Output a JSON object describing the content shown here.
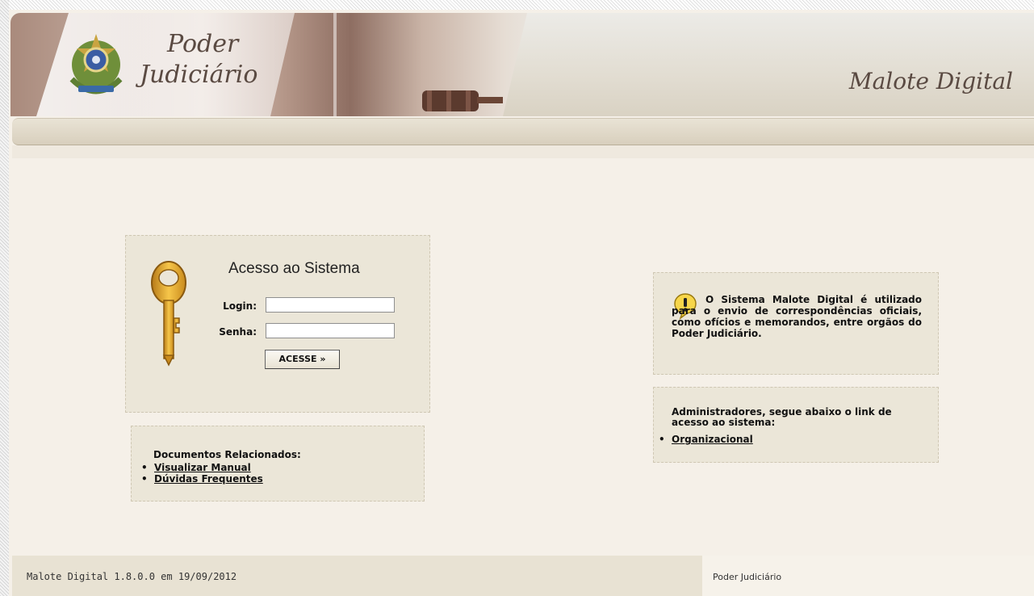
{
  "header": {
    "brand_line1": "Poder",
    "brand_line2": "Judiciário",
    "app_name": "Malote Digital"
  },
  "login": {
    "title": "Acesso ao Sistema",
    "login_label": "Login:",
    "senha_label": "Senha:",
    "login_value": "",
    "senha_value": "",
    "submit_label": "ACESSE »"
  },
  "documents": {
    "title": "Documentos Relacionados:",
    "links": [
      "Visualizar Manual",
      "Dúvidas Frequentes"
    ]
  },
  "info": {
    "text": "O Sistema Malote Digital é utilizado para o envio de correspondências oficiais, como ofícios e memorandos, entre orgãos do Poder Judiciário."
  },
  "admin": {
    "text": "Administradores, segue abaixo o link de acesso ao sistema:",
    "links": [
      "Organizacional"
    ]
  },
  "footer": {
    "version": "Malote Digital 1.8.0.0 em 19/09/2012",
    "org": "Poder Judiciário"
  },
  "icons": {
    "seal": "brazil-coat-of-arms-icon",
    "key": "key-icon",
    "info": "exclamation-bubble-icon"
  },
  "colors": {
    "page_bg": "#f5f0e8",
    "panel_bg": "#ebe6d8",
    "text": "#111111"
  }
}
